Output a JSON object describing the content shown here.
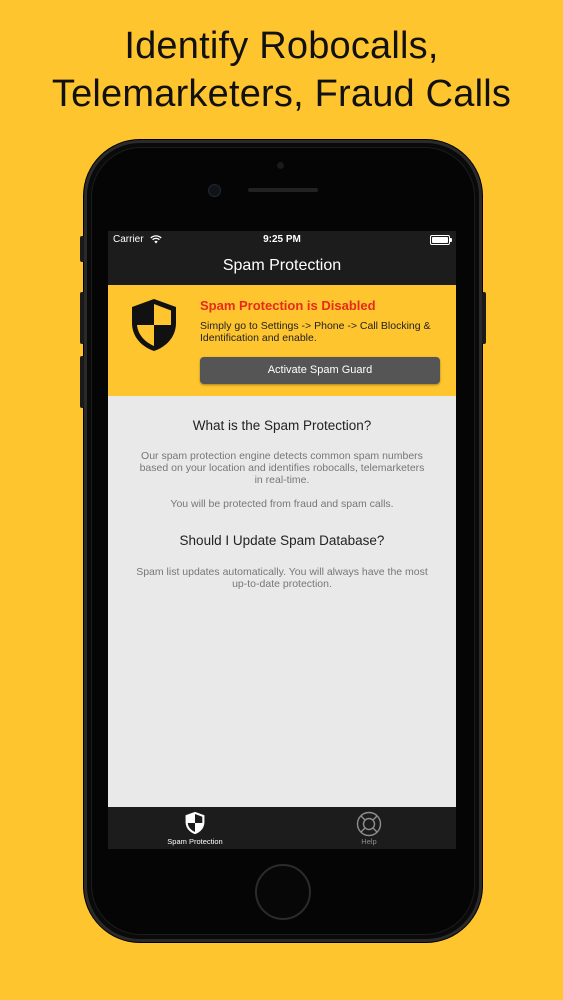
{
  "headline": {
    "line1": "Identify Robocalls,",
    "line2": "Telemarketers, Fraud Calls"
  },
  "status_bar": {
    "carrier": "Carrier",
    "time": "9:25 PM"
  },
  "nav": {
    "title": "Spam Protection"
  },
  "banner": {
    "title": "Spam Protection is Disabled",
    "text": "Simply go to Settings -> Phone -> Call Blocking & Identification and enable.",
    "button_label": "Activate Spam Guard"
  },
  "content": {
    "question1": "What is the Spam Protection?",
    "para1": "Our spam protection engine detects common spam numbers based on your location and identifies robocalls, telemarketers in real-time.",
    "para2": "You will be protected from fraud and spam calls.",
    "question2": "Should I Update Spam Database?",
    "para3": "Spam list updates automatically. You will always have the most up-to-date protection."
  },
  "tabs": [
    {
      "label": "Spam Protection",
      "icon": "shield-icon",
      "active": true
    },
    {
      "label": "Help",
      "icon": "lifebuoy-icon",
      "active": false
    }
  ],
  "colors": {
    "background": "#FEC52E",
    "alert_red": "#E62A1C",
    "bar_dark": "#1C1C1C",
    "button_gray": "#555555"
  }
}
